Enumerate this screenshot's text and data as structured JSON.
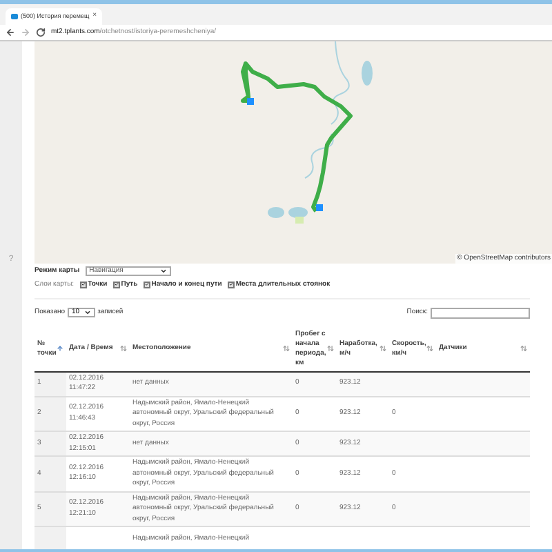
{
  "browser": {
    "tab": {
      "title": "(500) История перемещ",
      "close": "×"
    },
    "url_host": "mt2.tplants.com",
    "url_path": "/otchetnost/istoriya-peremeshcheniya/"
  },
  "sidebar": {
    "help": "?"
  },
  "map": {
    "attribution": "© OpenStreetMap contributors"
  },
  "map_mode": {
    "label": "Режим карты",
    "value": "Навигация"
  },
  "layers": {
    "label": "Слои карты:",
    "items": [
      {
        "label": "Точки",
        "checked": true
      },
      {
        "label": "Путь",
        "checked": true
      },
      {
        "label": "Начало и конец пути",
        "checked": true
      },
      {
        "label": "Места длительных стоянок",
        "checked": true
      }
    ]
  },
  "length": {
    "before": "Показано",
    "value": "10",
    "after": "записей"
  },
  "search": {
    "label": "Поиск:"
  },
  "table": {
    "columns": [
      "№ точки",
      "Дата / Время",
      "Местоположение",
      "Пробег с начала периода, км",
      "Наработка, м/ч",
      "Скорость, км/ч",
      "Датчики"
    ],
    "rows": [
      [
        "1",
        "02.12.2016 11:47:22",
        "нет данных",
        "0",
        "923.12",
        "",
        ""
      ],
      [
        "2",
        "02.12.2016 11:46:43",
        "Надымский район, Ямало-Ненецкий автономный округ, Уральский федеральный округ, Россия",
        "0",
        "923.12",
        "0",
        ""
      ],
      [
        "3",
        "02.12.2016 12:15:01",
        "нет данных",
        "0",
        "923.12",
        "",
        ""
      ],
      [
        "4",
        "02.12.2016 12:16:10",
        "Надымский район, Ямало-Ненецкий автономный округ, Уральский федеральный округ, Россия",
        "0",
        "923.12",
        "0",
        ""
      ],
      [
        "5",
        "02.12.2016 12:21:10",
        "Надымский район, Ямало-Ненецкий автономный округ, Уральский федеральный округ, Россия",
        "0",
        "923.12",
        "0",
        ""
      ],
      [
        "",
        "",
        "Надымский район, Ямало-Ненецкий",
        "",
        "",
        "",
        ""
      ]
    ]
  }
}
